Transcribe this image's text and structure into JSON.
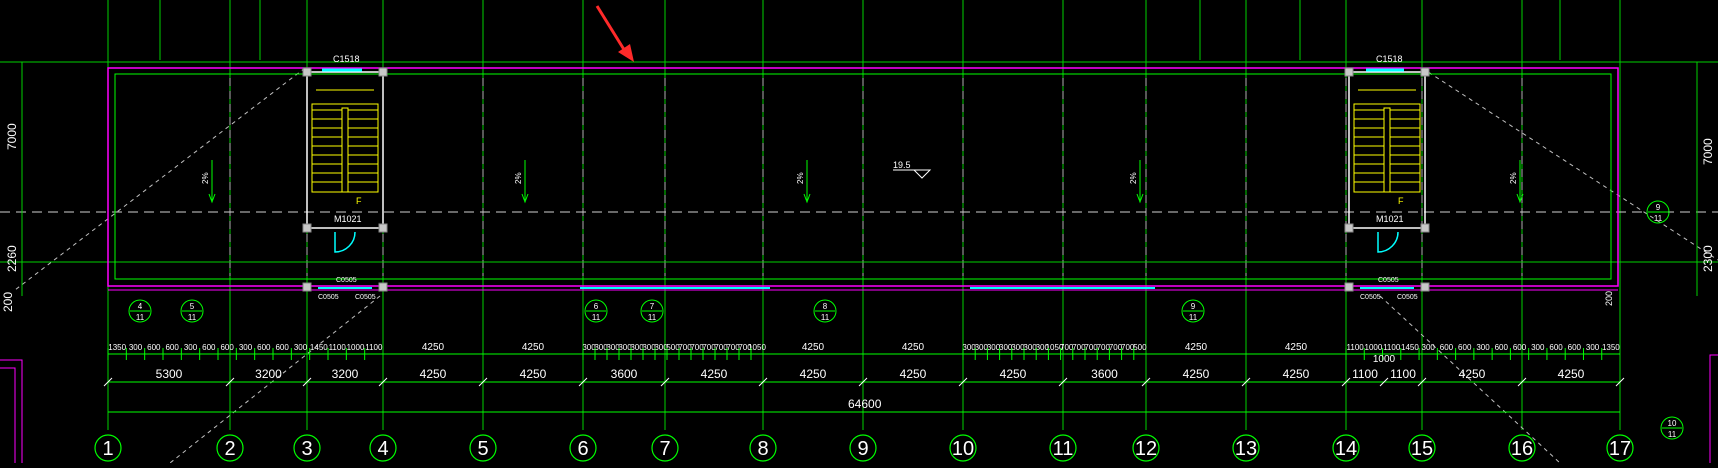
{
  "drawing": {
    "colors": {
      "background": "#000000",
      "grid": "#00d000",
      "wall": "#ff00ff",
      "wall_inner": "#00ff00",
      "annotation": "#ffffff",
      "stair": "#ffff00",
      "door": "#00ffff",
      "marker_arrow": "#ff2a2a",
      "column": "#c8c8c8"
    },
    "axis_labels": [
      "1",
      "2",
      "3",
      "4",
      "5",
      "6",
      "7",
      "8",
      "9",
      "10",
      "11",
      "12",
      "13",
      "14",
      "15",
      "16",
      "17"
    ],
    "dims_row2": [
      "5300",
      "3200",
      "3200",
      "4250",
      "4250",
      "3600",
      "4250",
      "4250",
      "4250",
      "4250",
      "3600",
      "4250",
      "4250",
      "1100",
      "1100",
      "4250",
      "4250"
    ],
    "dims_row2_extra": "1000",
    "dims_total": "64600",
    "dims_row1_outer": [
      "4250",
      "4250",
      "4250",
      "4250",
      "4250",
      "4250",
      "4250",
      "4250"
    ],
    "dims_row1_small_left": [
      "1350",
      "300",
      "600",
      "600",
      "300",
      "600",
      "600",
      "300",
      "600",
      "600",
      "300",
      "1450",
      "1100",
      "1000",
      "1100"
    ],
    "dims_row1_small_mid1": [
      "300",
      "300",
      "300",
      "300",
      "300",
      "300",
      "300",
      "500",
      "700",
      "700",
      "700",
      "700",
      "700",
      "700",
      "1050"
    ],
    "dims_row1_small_mid2": [
      "300",
      "300",
      "300",
      "300",
      "300",
      "300",
      "300",
      "1050",
      "700",
      "700",
      "700",
      "700",
      "700",
      "700",
      "500"
    ],
    "dims_row1_small_right": [
      "1100",
      "1000",
      "1100",
      "1450",
      "300",
      "600",
      "600",
      "300",
      "600",
      "600",
      "300",
      "600",
      "600",
      "300",
      "1350"
    ],
    "left_vertical_dims": [
      "7000",
      "2260",
      "200"
    ],
    "right_vertical_dims": [
      "7000",
      "2300",
      "200"
    ],
    "window_labels": {
      "top_left": "C1518",
      "top_right": "C1518",
      "small_a": "C0505",
      "small_b": "C0505",
      "small_c": "C0505"
    },
    "door_labels": {
      "left": "M1021",
      "right": "M1021"
    },
    "elevation": "19.5",
    "slope": "2%",
    "stair_up": "F",
    "section_markers": [
      {
        "top": "4",
        "bottom": "11"
      },
      {
        "top": "5",
        "bottom": "11"
      },
      {
        "top": "6",
        "bottom": "11"
      },
      {
        "top": "7",
        "bottom": "11"
      },
      {
        "top": "8",
        "bottom": "11"
      },
      {
        "top": "9",
        "bottom": "11"
      },
      {
        "top": "9",
        "bottom": "11"
      },
      {
        "top": "10",
        "bottom": "11"
      }
    ]
  }
}
